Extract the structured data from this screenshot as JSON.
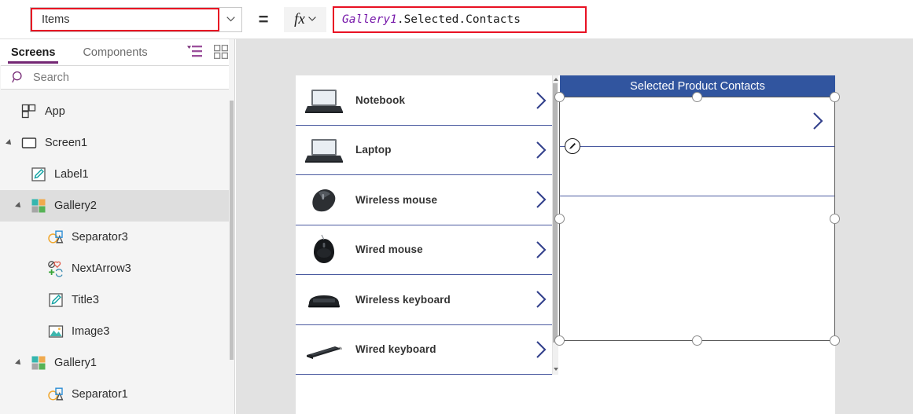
{
  "formula_bar": {
    "property_value": "Items",
    "property_caret_icon": "chevron-down-icon",
    "equals": "=",
    "fx_label": "fx",
    "fx_caret_icon": "chevron-down-icon",
    "formula_ident": "Gallery1",
    "formula_rest": ".Selected.Contacts",
    "accent_error_color": "#e81123",
    "ident_color": "#7719aa"
  },
  "sidebar": {
    "tabs": [
      {
        "label": "Screens",
        "active": true
      },
      {
        "label": "Components",
        "active": false
      }
    ],
    "view_icons": [
      {
        "name": "tree-view-icon",
        "color": "#742774"
      },
      {
        "name": "grid-view-icon",
        "color": "#8a8a8a"
      }
    ],
    "search": {
      "placeholder": "Search",
      "icon": "search-icon"
    },
    "tree": [
      {
        "label": "App",
        "level": 0,
        "icon": "app-icon",
        "expandable": false,
        "selected": false
      },
      {
        "label": "Screen1",
        "level": 0,
        "icon": "screen-icon",
        "expandable": true,
        "selected": false
      },
      {
        "label": "Label1",
        "level": 1,
        "icon": "label-icon",
        "expandable": false,
        "selected": false
      },
      {
        "label": "Gallery2",
        "level": 1,
        "icon": "gallery-icon",
        "expandable": true,
        "selected": true
      },
      {
        "label": "Separator3",
        "level": 2,
        "icon": "separator-icon",
        "expandable": false,
        "selected": false
      },
      {
        "label": "NextArrow3",
        "level": 2,
        "icon": "nextarrow-icon",
        "expandable": false,
        "selected": false
      },
      {
        "label": "Title3",
        "level": 2,
        "icon": "label-icon",
        "expandable": false,
        "selected": false
      },
      {
        "label": "Image3",
        "level": 2,
        "icon": "image-icon",
        "expandable": false,
        "selected": false
      },
      {
        "label": "Gallery1",
        "level": 1,
        "icon": "gallery-icon",
        "expandable": true,
        "selected": false
      },
      {
        "label": "Separator1",
        "level": 2,
        "icon": "separator-icon",
        "expandable": false,
        "selected": false
      }
    ]
  },
  "canvas": {
    "product_gallery": {
      "name": "Gallery1",
      "items": [
        {
          "title": "Notebook",
          "thumb": "laptop-photo"
        },
        {
          "title": "Laptop",
          "thumb": "laptop-photo"
        },
        {
          "title": "Wireless mouse",
          "thumb": "wireless-mouse-photo"
        },
        {
          "title": "Wired mouse",
          "thumb": "wired-mouse-photo"
        },
        {
          "title": "Wireless keyboard",
          "thumb": "wireless-keyboard-photo"
        },
        {
          "title": "Wired keyboard",
          "thumb": "wired-keyboard-photo"
        }
      ],
      "chevron_icon": "chevron-right-icon",
      "separator_color": "#4a5aa0",
      "scrollbar": true
    },
    "contacts_gallery": {
      "name": "Gallery2",
      "header_title": "Selected Product Contacts",
      "header_bg": "#31559f",
      "header_fg": "#ffffff",
      "rows": [
        {
          "chevron_icon": "chevron-right-icon"
        },
        {
          "chevron_icon": ""
        }
      ],
      "selected": true,
      "edit_badge_icon": "pencil-icon",
      "selection_handle_count": 8
    }
  }
}
